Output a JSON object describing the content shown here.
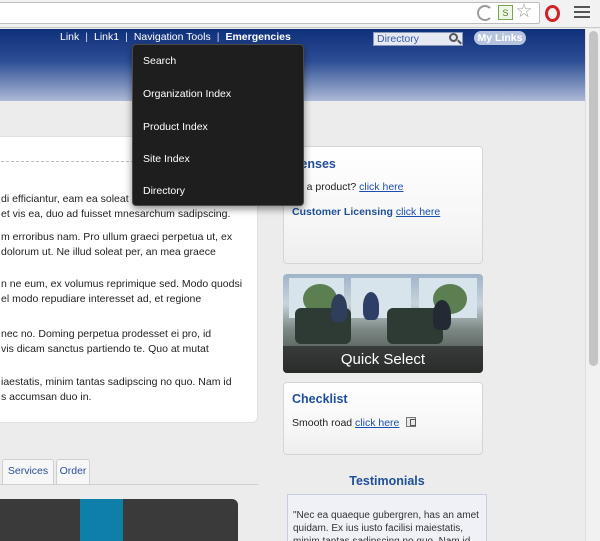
{
  "browser": {
    "icons": [
      "reload-icon",
      "rss-icon",
      "bookmark-star-icon",
      "opera-icon",
      "menu-icon"
    ]
  },
  "header": {
    "nav": [
      "Link",
      "Link1",
      "Navigation Tools",
      "Emergencies"
    ],
    "separator": "|",
    "search_placeholder": "Directory",
    "mylinks_label": "My Links"
  },
  "dropdown": {
    "items": [
      "Search",
      "Organization Index",
      "Product Index",
      "Site Index",
      "Directory"
    ]
  },
  "main": {
    "paragraphs": [
      [
        "di efficiantur, eam ea soleat",
        "et vis ea, duo ad fuisset mnesarchum sadipscing."
      ],
      [
        "m erroribus nam. Pro ullum graeci perpetua ut, ex",
        "dolorum ut. Ne illud soleat per, an mea graece"
      ],
      [
        "n ne eum, ex volumus reprimique sed. Modo quodsi",
        "el modo repudiare interesset ad, et regione"
      ],
      [
        "nec no. Doming perpetua prodesset ei pro, id",
        "vis dicam sanctus partiendo te. Quo at mutat"
      ],
      [
        "iaestatis, minim tantas sadipscing no quo. Nam id",
        "s accumsan duo in."
      ]
    ],
    "tabs": [
      "Services",
      "Order"
    ]
  },
  "licenses": {
    "title": "icenses",
    "line1_text": "ed a product?",
    "line1_link": "click here",
    "line2_bold": "Customer Licensing",
    "line2_link": "click here"
  },
  "photo": {
    "caption": "Quick Select"
  },
  "checklist": {
    "title": "Checklist",
    "text": "Smooth road",
    "link": "click here"
  },
  "testimonials": {
    "title": "Testimonials",
    "quote": "\"Nec ea quaeque gubergren, has an amet quidam. Ex ius iusto facilisi maiestatis, minim tantas sadipscing no quo. Nam id"
  },
  "colors": {
    "header_dark": "#0f2f7a",
    "link_blue": "#1a4fb0",
    "title_blue": "#1f4f9a",
    "dropdown_bg": "#1e1e1e",
    "teal": "#0d7fa8"
  }
}
